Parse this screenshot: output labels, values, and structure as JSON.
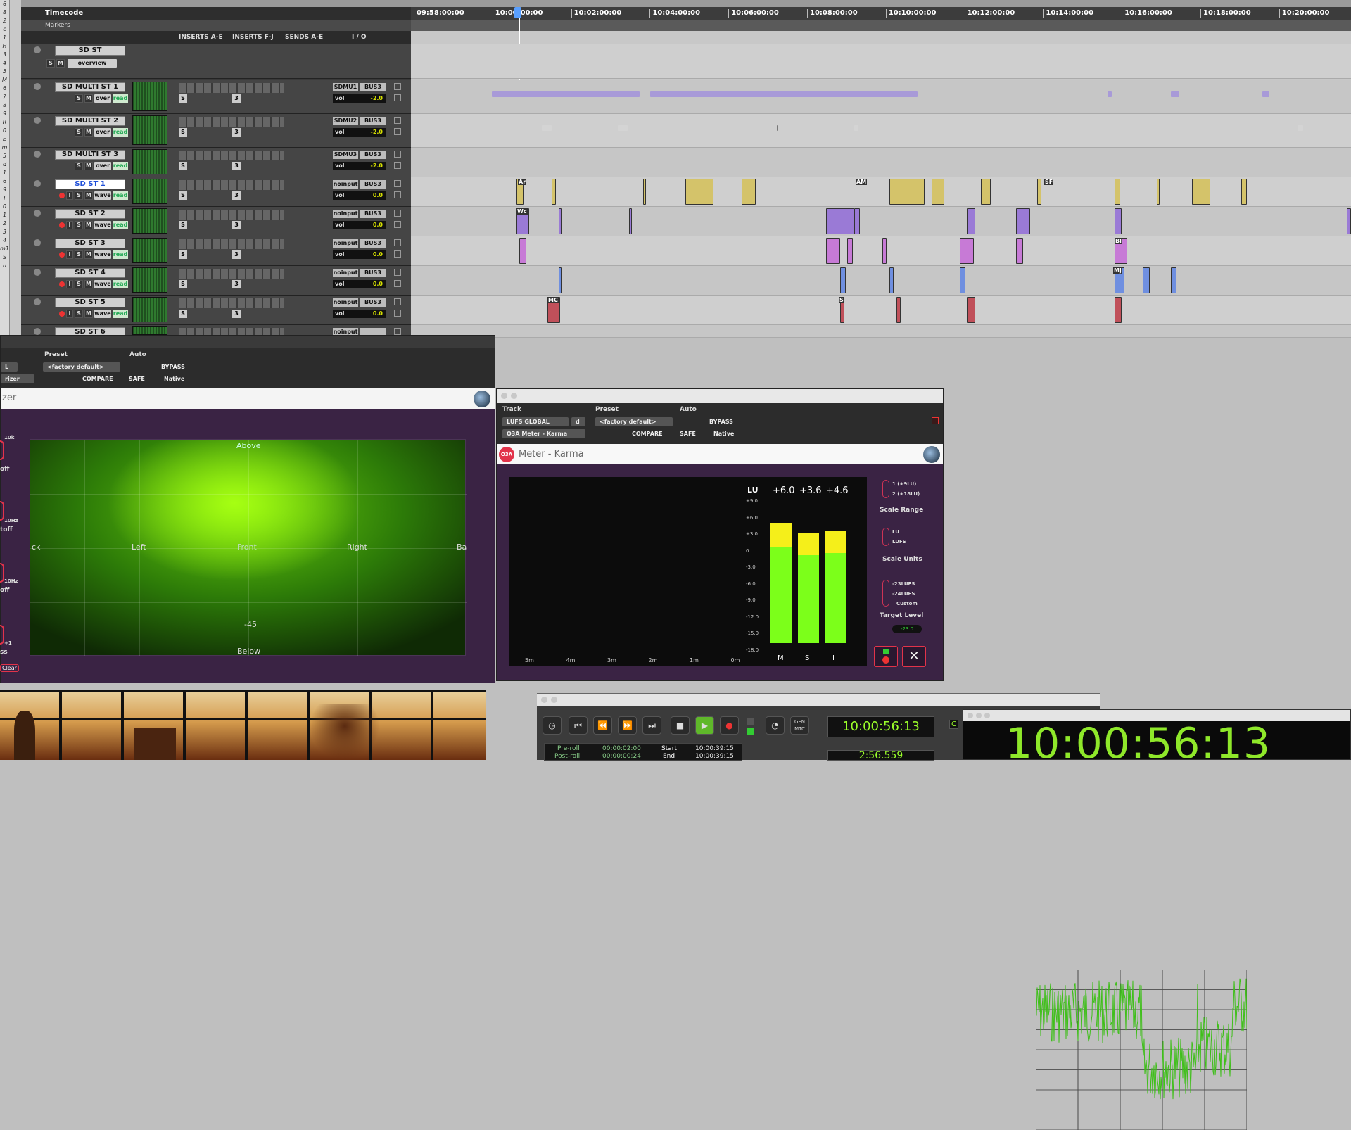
{
  "ruler": {
    "timecode_label": "Timecode",
    "markers_label": "Markers",
    "ticks": [
      "09:58:00:00",
      "10:00:00:00",
      "10:02:00:00",
      "10:04:00:00",
      "10:06:00:00",
      "10:08:00:00",
      "10:10:00:00",
      "10:12:00:00",
      "10:14:00:00",
      "10:16:00:00",
      "10:18:00:00",
      "10:20:00:00"
    ]
  },
  "header_row": {
    "inserts_ae": "INSERTS A-E",
    "inserts_fj": "INSERTS F-J",
    "sends_ae": "SENDS A-E",
    "io": "I / O"
  },
  "left_strip": [
    "6",
    "8",
    "2",
    "c",
    "1",
    "H",
    "3",
    "4",
    "5",
    "M",
    "6",
    "7",
    "8",
    "9",
    "R",
    "0",
    "E",
    "m",
    "5",
    "d",
    "1",
    "6",
    "9",
    "T",
    "0",
    "1",
    "2",
    "3",
    "4",
    "m1",
    "S",
    "u"
  ],
  "tracks": [
    {
      "name": "SD ST",
      "type": "folder",
      "mode": "overview"
    },
    {
      "name": "SD MULTI ST 1",
      "view": "over",
      "auto": "read",
      "input": "SDMU1",
      "output": "BUS3",
      "vol": "-2.0"
    },
    {
      "name": "SD MULTI ST 2",
      "view": "over",
      "auto": "read",
      "input": "SDMU2",
      "output": "BUS3",
      "vol": "-2.0"
    },
    {
      "name": "SD MULTI ST 3",
      "view": "over",
      "auto": "read",
      "input": "SDMU3",
      "output": "BUS3",
      "vol": "-2.0"
    },
    {
      "name": "SD ST 1",
      "view": "wave",
      "auto": "read",
      "input": "noinput",
      "output": "BUS3",
      "vol": "0.0",
      "selected": true
    },
    {
      "name": "SD ST 2",
      "view": "wave",
      "auto": "read",
      "input": "noinput",
      "output": "BUS3",
      "vol": "0.0"
    },
    {
      "name": "SD ST 3",
      "view": "wave",
      "auto": "read",
      "input": "noinput",
      "output": "BUS3",
      "vol": "0.0"
    },
    {
      "name": "SD ST 4",
      "view": "wave",
      "auto": "read",
      "input": "noinput",
      "output": "BUS3",
      "vol": "0.0"
    },
    {
      "name": "SD ST 5",
      "view": "wave",
      "auto": "read",
      "input": "noinput",
      "output": "BUS3",
      "vol": "0.0"
    },
    {
      "name": "SD ST 6",
      "view": "",
      "auto": "",
      "input": "noinput",
      "output": "",
      "vol": ""
    }
  ],
  "clip_labels": [
    "Ar",
    "AM",
    "SF",
    "Wc",
    "Bl",
    "Mj",
    "MC",
    "S"
  ],
  "plugin_left": {
    "preset_label": "Preset",
    "auto_label": "Auto",
    "factory_default": "<factory default>",
    "bypass": "BYPASS",
    "compare": "COMPARE",
    "safe": "SAFE",
    "native": "Native",
    "title_fragment": "zer",
    "left_small": "L",
    "left_field2": "rizer",
    "labels": {
      "above": "Above",
      "left": "Left",
      "front": "Front",
      "right": "Right",
      "back_left": "ck",
      "back_right": "Ba",
      "below": "Below",
      "level": "-45"
    },
    "side": {
      "k10": "10k",
      "off": "off",
      "hz10": "10Hz",
      "cutoff": "toff",
      "hz10b": "10Hz",
      "off2": "off",
      "plus1": "+1",
      "ss": "ss",
      "clear": "Clear"
    }
  },
  "plugin_meter": {
    "track_label": "Track",
    "preset_label": "Preset",
    "auto_label": "Auto",
    "track_name": "LUFS GLOBAL",
    "track_suffix": "d",
    "factory_default": "<factory default>",
    "bypass": "BYPASS",
    "insert_name": "O3A Meter - Karma",
    "compare": "COMPARE",
    "safe": "SAFE",
    "native": "Native",
    "badge": "O3A",
    "title": "Meter - Karma",
    "lu_label": "LU",
    "readouts": {
      "M": "+6.0",
      "S": "+3.6",
      "I": "+4.6"
    },
    "scale": [
      "+9.0",
      "+6.0",
      "+3.0",
      "0",
      "-3.0",
      "-6.0",
      "-9.0",
      "-12.0",
      "-15.0",
      "-18.0"
    ],
    "time_axis": [
      "5m",
      "4m",
      "3m",
      "2m",
      "1m",
      "0m"
    ],
    "bar_labels": [
      "M",
      "S",
      "I"
    ],
    "bar_levels": {
      "M": 0.84,
      "S": 0.77,
      "I": 0.79
    },
    "scale_range": {
      "opt1": "1 (+9LU)",
      "opt2": "2 (+18LU)",
      "title": "Scale Range"
    },
    "scale_units": {
      "opt1": "LU",
      "opt2": "LUFS",
      "title": "Scale Units"
    },
    "target_level": {
      "opt1": "-23LUFS",
      "opt2": "-24LUFS",
      "opt3": "Custom",
      "title": "Target Level",
      "value": "-23.0"
    }
  },
  "transport": {
    "gen_mtc": "GEN MTC",
    "counter_main": "10:00:56:13",
    "counter_sub": "2:56.559",
    "preroll_label": "Pre-roll",
    "preroll_value": "00:00:02:00",
    "postroll_label": "Post-roll",
    "postroll_value": "00:00:00:24",
    "start_label": "Start",
    "start_value": "10:00:39:15",
    "end_label": "End",
    "end_value": "10:00:39:15"
  },
  "big_counter": {
    "value": "10:00:56:13",
    "side": "C"
  },
  "colors": {
    "accent_green": "#7cff1a",
    "meter_yellow": "#f5ef1a",
    "plugin_bg": "#3a2344",
    "badge_red": "#e2334a"
  }
}
